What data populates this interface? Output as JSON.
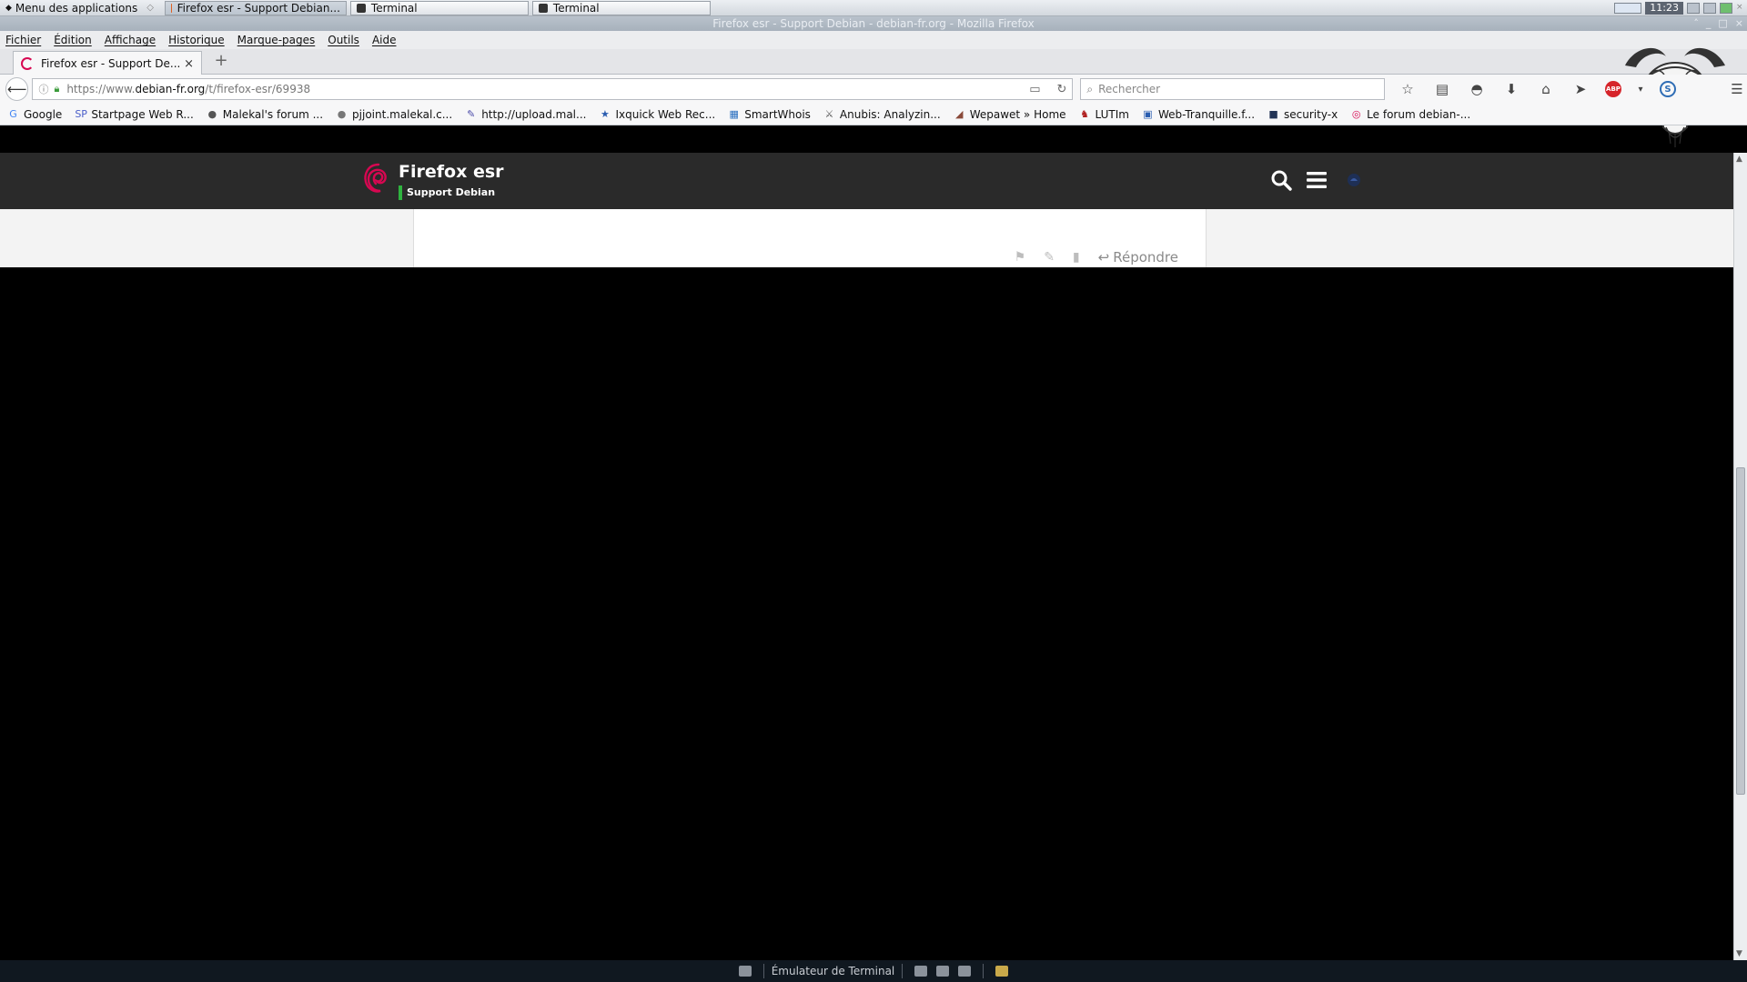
{
  "top_panel": {
    "app_menu": "Menu des applications",
    "tasks": [
      {
        "label": "Firefox esr - Support Debian...",
        "active": true
      },
      {
        "label": "Terminal",
        "active": false
      },
      {
        "label": "Terminal",
        "active": false
      }
    ],
    "clock": "11:23"
  },
  "window": {
    "title": "Firefox esr - Support Debian - debian-fr.org - Mozilla Firefox"
  },
  "menubar": {
    "items": [
      "Fichier",
      "Édition",
      "Affichage",
      "Historique",
      "Marque-pages",
      "Outils",
      "Aide"
    ]
  },
  "tabs": {
    "active_title": "Firefox esr - Support De...",
    "close_glyph": "×",
    "new_tab_glyph": "+"
  },
  "navbar": {
    "url_prefix": "https://www.",
    "url_domain": "debian-fr.org",
    "url_path": "/t/firefox-esr/69938",
    "search_placeholder": "Rechercher"
  },
  "bookmarks": [
    {
      "label": "Google",
      "icon": "G",
      "color": "#4285f4"
    },
    {
      "label": "Startpage Web R...",
      "icon": "SP",
      "color": "#4a5ec9"
    },
    {
      "label": "Malekal's forum ...",
      "icon": "●",
      "color": "#555555"
    },
    {
      "label": "pjjoint.malekal.c...",
      "icon": "●",
      "color": "#777777"
    },
    {
      "label": "http://upload.mal...",
      "icon": "✎",
      "color": "#4a4aa8"
    },
    {
      "label": "Ixquick Web Rec...",
      "icon": "★",
      "color": "#2a5db0"
    },
    {
      "label": "SmartWhois",
      "icon": "▦",
      "color": "#2a6fc0"
    },
    {
      "label": "Anubis: Analyzin...",
      "icon": "⚔",
      "color": "#555555"
    },
    {
      "label": "Wepawet » Home",
      "icon": "◢",
      "color": "#8a4a3a"
    },
    {
      "label": "LUTIm",
      "icon": "♞",
      "color": "#b02020"
    },
    {
      "label": "Web-Tranquille.f...",
      "icon": "▣",
      "color": "#2a5db0"
    },
    {
      "label": "security-x",
      "icon": "■",
      "color": "#223355"
    },
    {
      "label": "Le forum debian-...",
      "icon": "◎",
      "color": "#d70751"
    }
  ],
  "site": {
    "title": "Firefox esr",
    "subtitle": "Support Debian",
    "brand_color": "#d70751",
    "category_color": "#2fb33f",
    "reply_label": "Répondre"
  },
  "bottom_panel": {
    "launcher_label": "Émulateur de Terminal"
  }
}
